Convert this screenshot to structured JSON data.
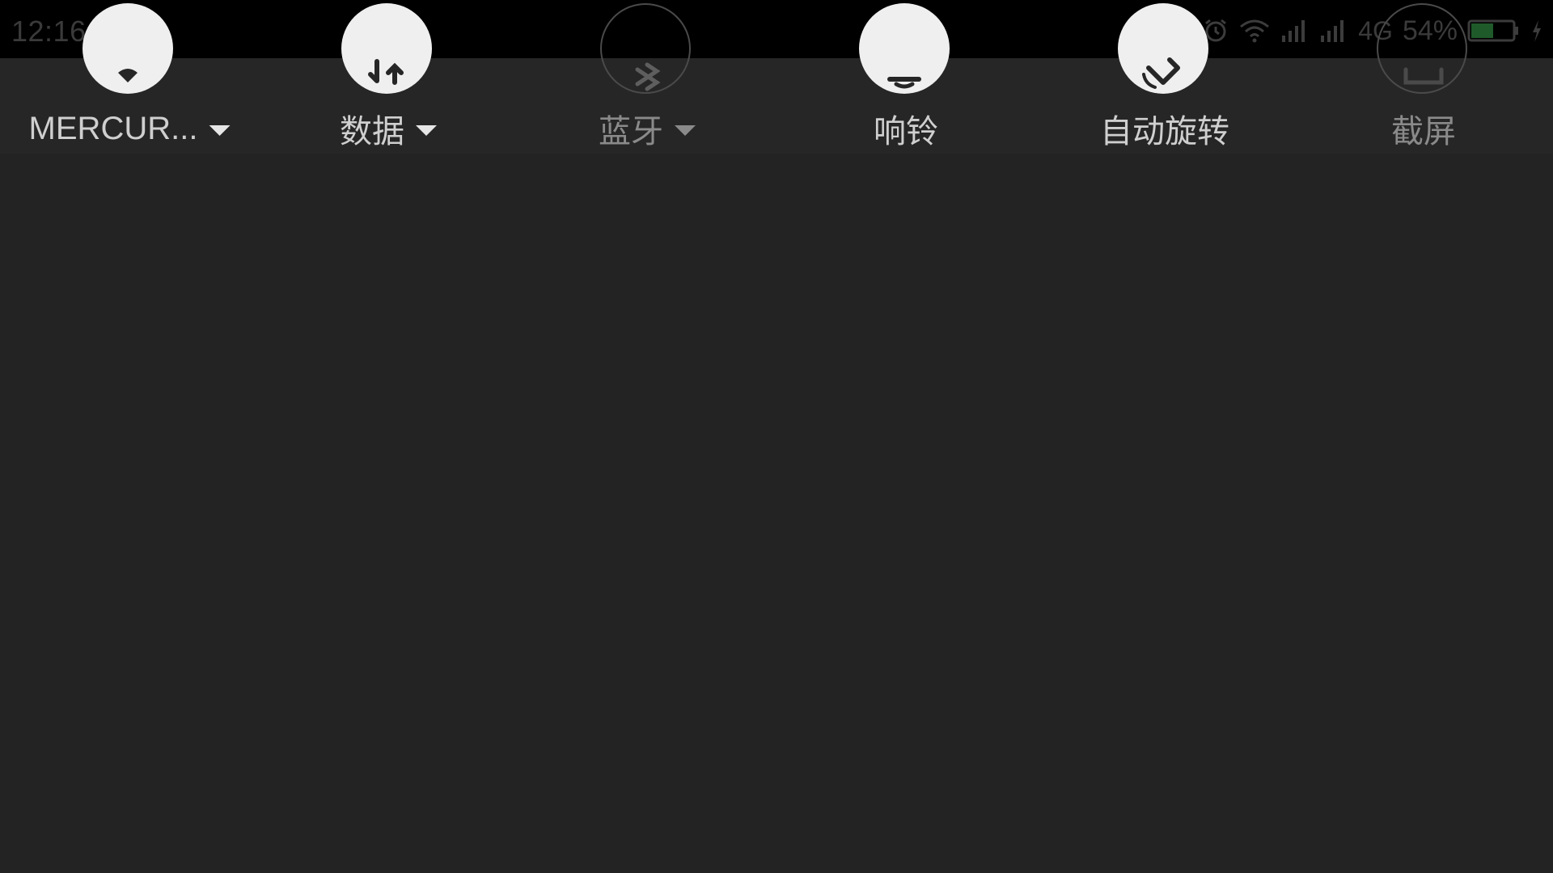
{
  "status_bar": {
    "time": "12:16",
    "network_type": "4G",
    "battery_percent": "54%",
    "battery_level": 0.54,
    "battery_color": "#1f5a2a",
    "icons": [
      "alarm-icon",
      "wifi-icon",
      "signal-icon",
      "signal-icon",
      "charging-icon"
    ]
  },
  "quick_settings": {
    "tiles": [
      {
        "id": "wifi",
        "label": "MERCUR...",
        "state": "on",
        "has_dropdown": true,
        "icon": "wifi-icon"
      },
      {
        "id": "data",
        "label": "数据",
        "state": "on",
        "has_dropdown": true,
        "icon": "data-arrows-icon"
      },
      {
        "id": "bluetooth",
        "label": "蓝牙",
        "state": "off",
        "has_dropdown": true,
        "icon": "bluetooth-icon"
      },
      {
        "id": "ring",
        "label": "响铃",
        "state": "on",
        "has_dropdown": false,
        "icon": "bell-icon"
      },
      {
        "id": "autorotate",
        "label": "自动旋转",
        "state": "on",
        "has_dropdown": false,
        "icon": "rotate-icon"
      },
      {
        "id": "screenshot",
        "label": "截屏",
        "state": "off",
        "has_dropdown": false,
        "icon": "screenshot-icon"
      }
    ]
  },
  "colors": {
    "background": "#232323",
    "status_bar": "#000000",
    "tile_active": "#efefef",
    "label_text": "#cfcfcf",
    "label_dim": "#8a8a8a"
  }
}
